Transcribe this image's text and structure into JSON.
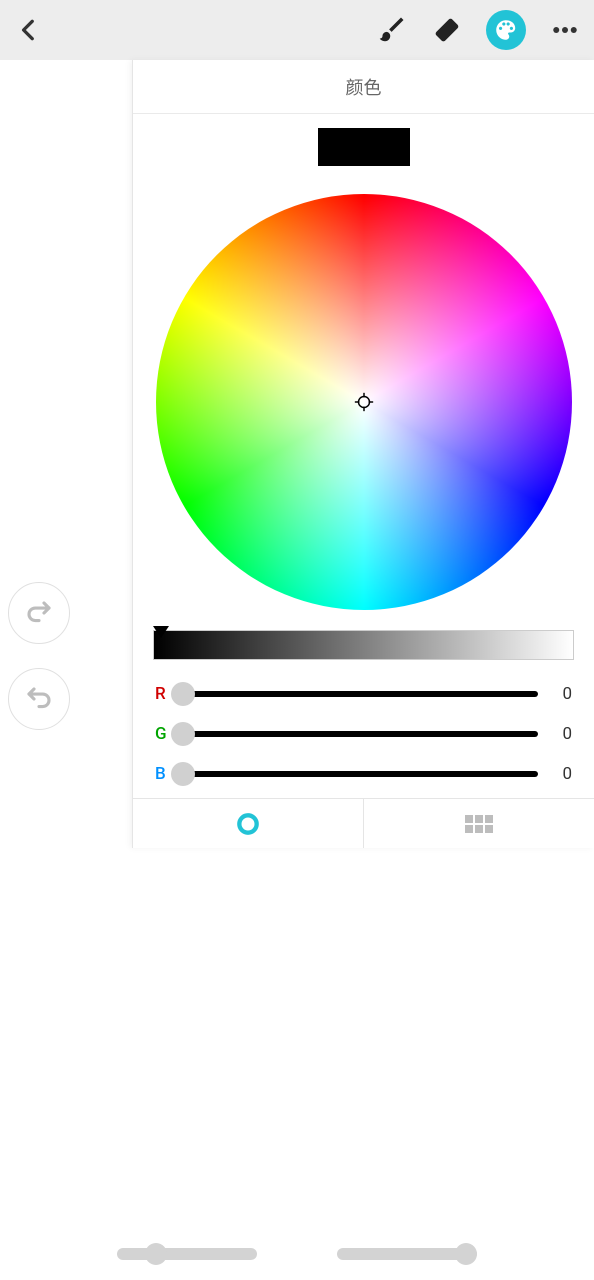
{
  "toolbar": {
    "active_tool": "palette"
  },
  "color_panel": {
    "title": "颜色",
    "current_color_hex": "#000000",
    "brightness": 0,
    "channels": [
      {
        "key": "R",
        "value": 0
      },
      {
        "key": "G",
        "value": 0
      },
      {
        "key": "B",
        "value": 0
      }
    ],
    "active_tab": "wheel"
  },
  "bottom": {
    "slider_left": {
      "value": 28,
      "max": 100
    },
    "slider_right": {
      "value": 92,
      "max": 100
    }
  },
  "icons": {
    "back": "back-icon",
    "brush": "brush-icon",
    "eraser": "eraser-icon",
    "palette": "palette-icon",
    "more": "more-icon",
    "redo": "redo-icon",
    "undo": "undo-icon",
    "wheel_tab": "wheel-tab-icon",
    "grid_tab": "grid-tab-icon"
  }
}
